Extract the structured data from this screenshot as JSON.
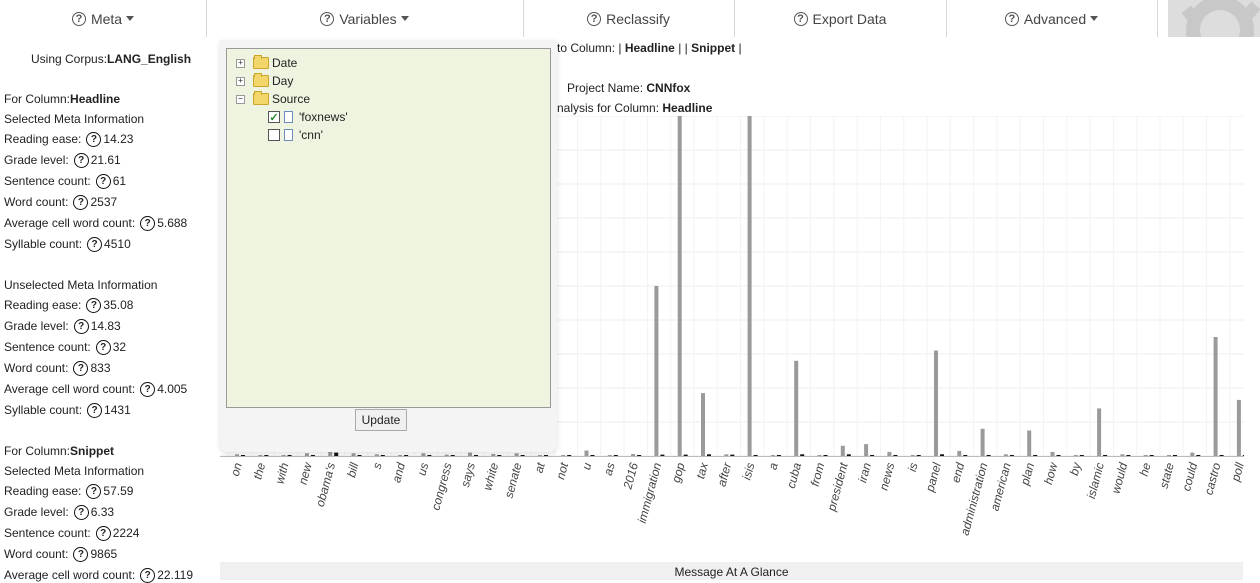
{
  "nav": {
    "items": [
      {
        "label": "Meta",
        "dropdown": true
      },
      {
        "label": "Variables",
        "dropdown": true
      },
      {
        "label": "Reclassify",
        "dropdown": false
      },
      {
        "label": "Export Data",
        "dropdown": false
      },
      {
        "label": "Advanced",
        "dropdown": true
      }
    ]
  },
  "left_panel": {
    "corpus_label": "Using Corpus:",
    "corpus_name": "LANG_English",
    "sections": [
      {
        "column_label": "For Column: ",
        "column_name": "Headline",
        "groups": [
          {
            "title": "Selected Meta Information",
            "metrics": [
              {
                "label": "Reading ease:",
                "value": "14.23"
              },
              {
                "label": "Grade level:",
                "value": "21.61"
              },
              {
                "label": "Sentence count:",
                "value": "61"
              },
              {
                "label": "Word count:",
                "value": "2537"
              },
              {
                "label": "Average cell word count:",
                "value": "5.688"
              },
              {
                "label": "Syllable count:",
                "value": "4510"
              }
            ]
          },
          {
            "title": "Unselected Meta Information",
            "metrics": [
              {
                "label": "Reading ease:",
                "value": "35.08"
              },
              {
                "label": "Grade level:",
                "value": "14.83"
              },
              {
                "label": "Sentence count:",
                "value": "32"
              },
              {
                "label": "Word count:",
                "value": "833"
              },
              {
                "label": "Average cell word count:",
                "value": "4.005"
              },
              {
                "label": "Syllable count:",
                "value": "1431"
              }
            ]
          }
        ]
      },
      {
        "column_label": "For Column: ",
        "column_name": "Snippet",
        "groups": [
          {
            "title": "Selected Meta Information",
            "metrics": [
              {
                "label": "Reading ease:",
                "value": "57.59"
              },
              {
                "label": "Grade level:",
                "value": "6.33"
              },
              {
                "label": "Sentence count:",
                "value": "2224"
              },
              {
                "label": "Word count:",
                "value": "9865"
              },
              {
                "label": "Average cell word count:",
                "value": "22.119"
              }
            ]
          }
        ]
      }
    ]
  },
  "main": {
    "columns_prefix": "to Column: |",
    "col1": "Headline",
    "sep": "| |",
    "col2": "Snippet",
    "end": "|",
    "project_label": "Project Name: ",
    "project_name": "CNNfox",
    "analysis_prefix": "nalysis for Column: ",
    "analysis_column": "Headline",
    "footer": "Message At A Glance"
  },
  "popup": {
    "tree": [
      {
        "label": "Date",
        "toggle": "+",
        "type": "folder"
      },
      {
        "label": "Day",
        "toggle": "+",
        "type": "folder"
      },
      {
        "label": "Source",
        "toggle": "−",
        "type": "folder"
      },
      {
        "label": "'foxnews'",
        "type": "leaf",
        "checked": true
      },
      {
        "label": "'cnn'",
        "type": "leaf",
        "checked": false
      }
    ],
    "update_label": "Update"
  },
  "chart_data": {
    "type": "bar",
    "categories": [
      "on",
      "the",
      "with",
      "new",
      "obama's",
      "bill",
      "s",
      "and",
      "us",
      "congress",
      "says",
      "white",
      "senate",
      "at",
      "not",
      "u",
      "as",
      "2016",
      "immigration",
      "gop",
      "tax",
      "after",
      "isis",
      "a",
      "cuba",
      "from",
      "president",
      "iran",
      "news",
      "is",
      "panel",
      "end",
      "administration",
      "american",
      "plan",
      "how",
      "by",
      "islamic",
      "would",
      "he",
      "state",
      "could",
      "castro",
      "poll"
    ],
    "series": [
      {
        "color": "#9a9a9a",
        "values": [
          0.5,
          0.3,
          0.3,
          0.8,
          1.2,
          0.8,
          0.5,
          0.3,
          0.8,
          0.4,
          1.0,
          0.6,
          0.8,
          0.3,
          0.3,
          1.6,
          0.3,
          0.6,
          50,
          100,
          18.5,
          0.5,
          100,
          0.3,
          28,
          0.3,
          3,
          3.5,
          1.2,
          0.3,
          31,
          1.5,
          8,
          0.5,
          7.5,
          1.2,
          0.3,
          14,
          0.5,
          0.3,
          0.3,
          1.0,
          35,
          16.5
        ]
      },
      {
        "color": "#111111",
        "values": [
          0.2,
          0.2,
          0.2,
          0.2,
          1.0,
          0.2,
          0.2,
          0.2,
          0.2,
          0.2,
          0.2,
          0.2,
          0.2,
          0.2,
          0.2,
          0.2,
          0.2,
          0.2,
          0.4,
          0.4,
          0.5,
          0.4,
          0.3,
          0.2,
          0.5,
          0.2,
          0.5,
          0.3,
          0.3,
          0.2,
          0.5,
          0.2,
          0.3,
          0.2,
          0.3,
          0.2,
          0.2,
          0.3,
          0.2,
          0.2,
          0.2,
          0.2,
          0.3,
          0.3
        ]
      }
    ],
    "ylim": [
      0,
      100
    ],
    "grid": true
  }
}
